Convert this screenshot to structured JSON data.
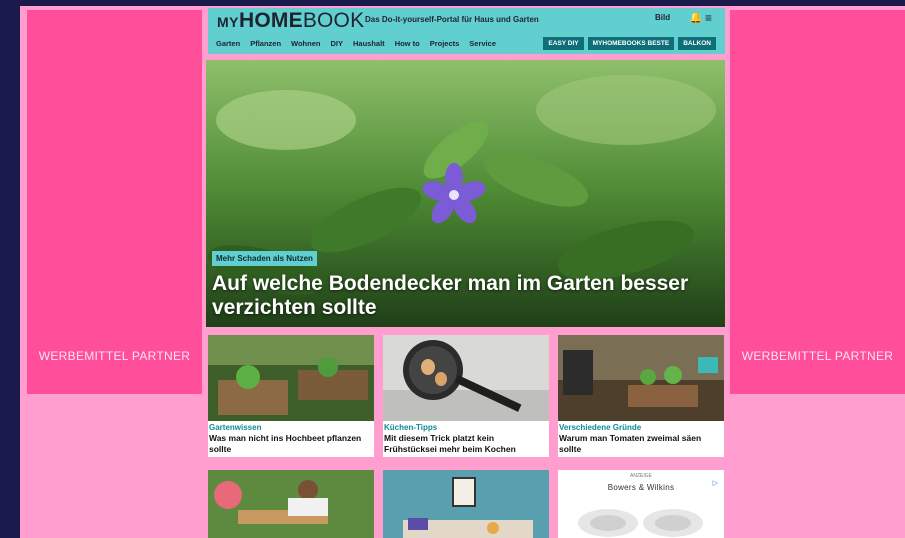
{
  "ads": {
    "left_label": "WERBEMITTEL PARTNER",
    "right_label": "WERBEMITTEL PARTNER"
  },
  "header": {
    "logo_my": "MY",
    "logo_home": "HOME",
    "logo_book": "BOOK",
    "tagline": "Das Do-it-yourself-Portal für Haus und Garten",
    "partner_badge": "Bild",
    "nav": [
      "Garten",
      "Pflanzen",
      "Wohnen",
      "DIY",
      "Haushalt",
      "How to",
      "Projects",
      "Service"
    ],
    "pills": [
      "EASY DIY",
      "MYHOMEBOOKS BESTE",
      "BALKON"
    ]
  },
  "hero": {
    "kicker": "Mehr Schaden als Nutzen",
    "title": "Auf welche Bodendecker man im Garten besser verzichten sollte"
  },
  "cards": [
    {
      "category": "Gartenwissen",
      "headline": "Was man nicht ins Hochbeet pflanzen sollte"
    },
    {
      "category": "Küchen-Tipps",
      "headline": "Mit diesem Trick platzt kein Frühstücksei mehr beim Kochen"
    },
    {
      "category": "Verschiedene Gründe",
      "headline": "Warum man Tomaten zweimal säen sollte"
    }
  ],
  "ad_card": {
    "label": "ANZEIGE",
    "brand": "Bowers & Wilkins"
  },
  "colors": {
    "page_bg": "#ff9ecf",
    "ad_bg": "#ff4e9a",
    "header_bg": "#61cfcf",
    "pill_bg": "#0f6f78",
    "category_text": "#0f8b95"
  }
}
